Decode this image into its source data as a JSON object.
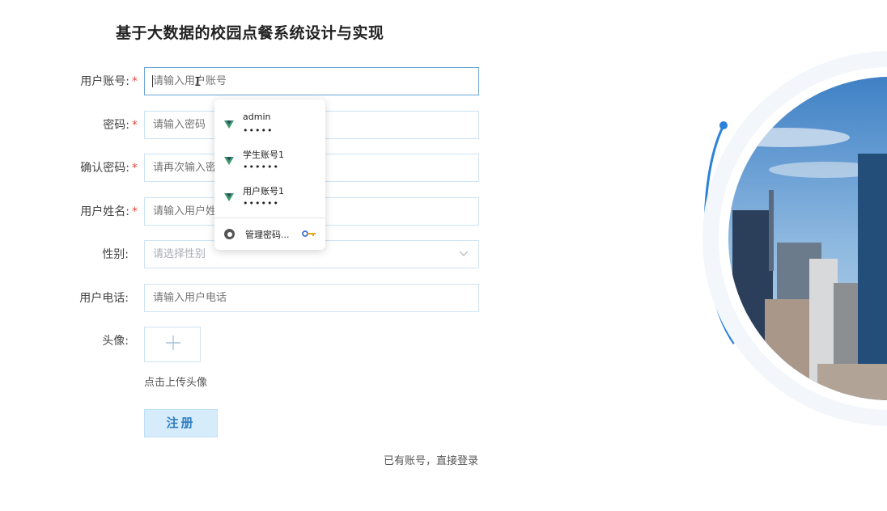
{
  "page": {
    "title": "基于大数据的校园点餐系统设计与实现"
  },
  "form": {
    "fields": [
      {
        "label": "用户账号",
        "required": true,
        "placeholder": "请输入用户账号",
        "type": "text"
      },
      {
        "label": "密码",
        "required": true,
        "placeholder": "请输入密码",
        "type": "password"
      },
      {
        "label": "确认密码",
        "required": true,
        "placeholder": "请再次输入密码",
        "type": "password"
      },
      {
        "label": "用户姓名",
        "required": true,
        "placeholder": "请输入用户姓名",
        "type": "text"
      },
      {
        "label": "性别",
        "required": false,
        "placeholder": "请选择性别",
        "type": "select"
      },
      {
        "label": "用户电话",
        "required": false,
        "placeholder": "请输入用户电话",
        "type": "text"
      }
    ],
    "avatar_label": "头像",
    "upload_hint": "点击上传头像",
    "register_label": "注册",
    "login_link": "已有账号，直接登录",
    "required_mark": "*"
  },
  "autofill": {
    "credentials": [
      {
        "username": "admin",
        "password_mask": "•••••"
      },
      {
        "username": "学生账号1",
        "password_mask": "••••••"
      },
      {
        "username": "用户账号1",
        "password_mask": "••••••"
      }
    ],
    "manage_label": "管理密码..."
  },
  "colors": {
    "accent": "#2f7ec2",
    "required": "#e8463c",
    "input_border": "#cfe3f2",
    "focused_border": "#6aa6d8",
    "button_bg": "#d6ecfa",
    "vue_green": "#2f8a6a"
  }
}
